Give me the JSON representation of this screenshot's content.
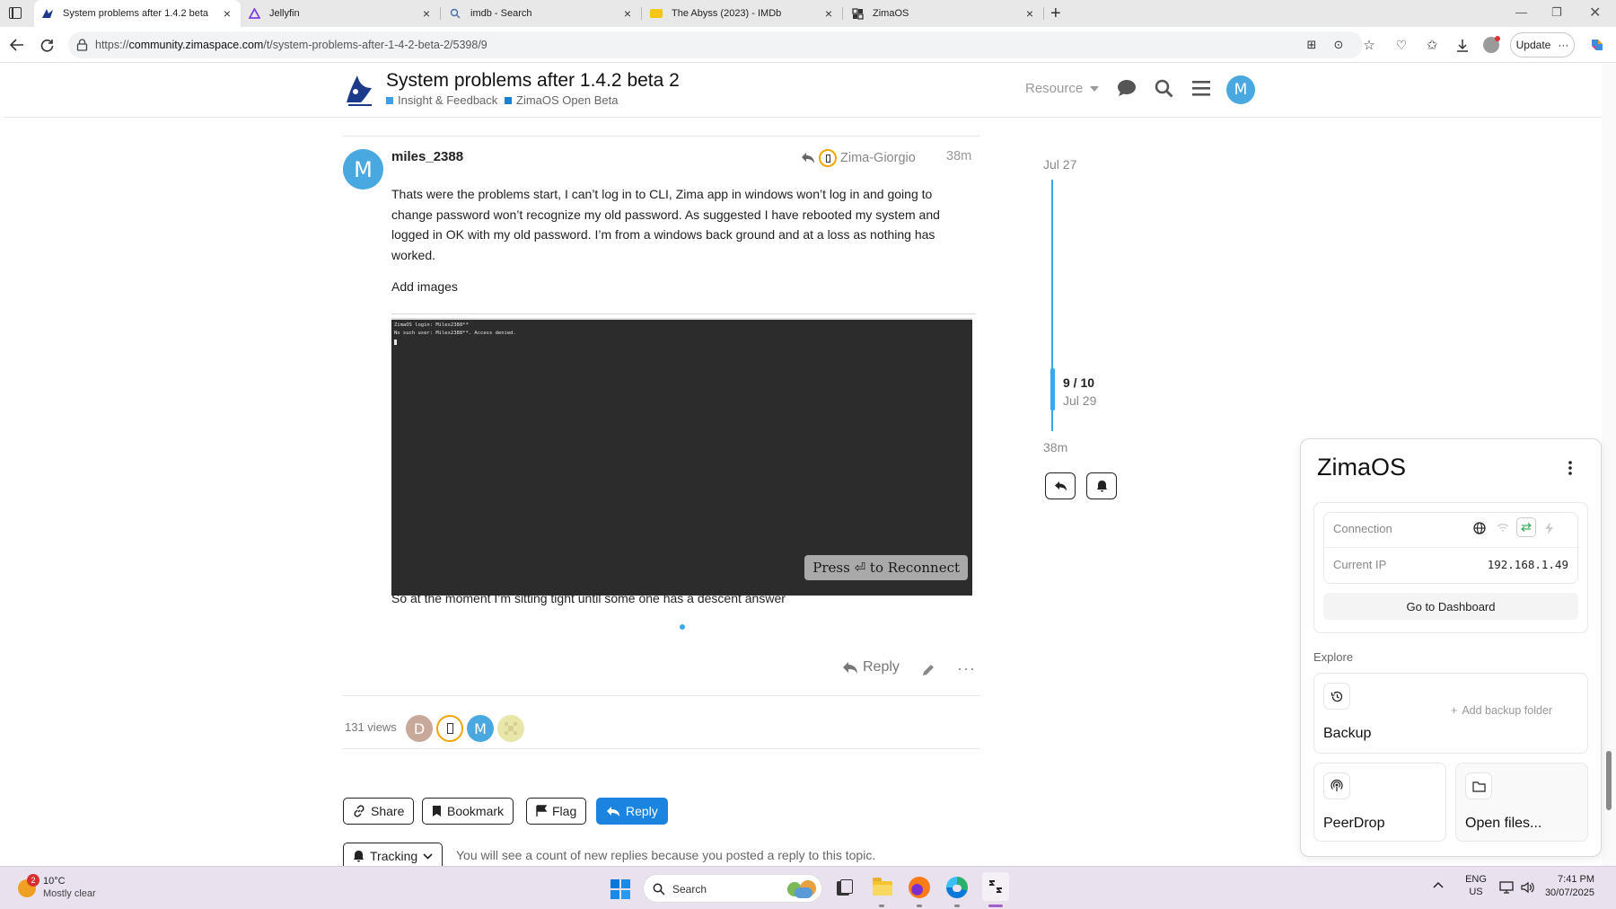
{
  "browser": {
    "tabs": [
      {
        "title": "System problems after 1.4.2 beta",
        "icon": "zimaos-whale-icon",
        "active": true
      },
      {
        "title": "Jellyfin",
        "icon": "jellyfin-icon"
      },
      {
        "title": "imdb - Search",
        "icon": "search-icon"
      },
      {
        "title": "The Abyss (2023) - IMDb",
        "icon": "imdb-icon"
      },
      {
        "title": "ZimaOS",
        "icon": "zimaos-icon"
      }
    ],
    "url_prefix": "https://",
    "url_domain": "community.zimaspace.com",
    "url_path": "/t/system-problems-after-1-4-2-beta-2/5398/9",
    "update_label": "Update"
  },
  "header": {
    "title": "System problems after 1.4.2 beta 2",
    "categories": [
      {
        "label": "Insight & Feedback",
        "color": "#3aa0e8"
      },
      {
        "label": "ZimaOS Open Beta",
        "color": "#1e7ed0"
      }
    ],
    "resource_label": "Resource",
    "avatar_letter": "M"
  },
  "post": {
    "avatar_letter": "M",
    "username": "miles_2388",
    "reply_to": "Zima-Giorgio",
    "time": "38m",
    "paragraph1": "Thats were the problems start, I can’t log in to CLI, Zima app in windows won’t log in and going to change password won’t recognize my old password. As suggested I have rebooted my system and logged in OK with my old password. I’m from a windows back ground and at a loss as nothing has worked.",
    "paragraph2": "Add images",
    "terminal_line1": "ZimaOS login: Miles2388**",
    "terminal_line2": "No such user: Miles2388**. Access denied.",
    "reconnect_label": "Press ⏎ to Reconnect",
    "paragraph3": "So at the moment I’m sitting tight until some one has a descent answer",
    "reply_label": "Reply"
  },
  "footer": {
    "views": "131 views",
    "participants": [
      {
        "letter": "D",
        "color": "#c8a89a"
      },
      {
        "letter": "",
        "color": "#f0a500"
      },
      {
        "letter": "M",
        "color": "#4aa8e0"
      },
      {
        "letter": "",
        "color": "#e8e6a8"
      }
    ],
    "buttons": {
      "share": "Share",
      "bookmark": "Bookmark",
      "flag": "Flag",
      "reply": "Reply"
    },
    "tracking_label": "Tracking",
    "tracking_note": "You will see a count of new replies because you posted a reply to this topic."
  },
  "timeline": {
    "start_date": "Jul 27",
    "position": "9 / 10",
    "current_date": "Jul 29",
    "end_label": "38m"
  },
  "zima_panel": {
    "title": "ZimaOS",
    "connection_label": "Connection",
    "current_ip_label": "Current IP",
    "current_ip": "192.168.1.49",
    "dashboard_button": "Go to Dashboard",
    "explore_label": "Explore",
    "backup_label": "Backup",
    "add_backup_label": "Add backup folder",
    "peerdrop_label": "PeerDrop",
    "open_files_label": "Open files..."
  },
  "taskbar": {
    "weather_badge": "2",
    "temperature": "10°C",
    "weather": "Mostly clear",
    "search_placeholder": "Search",
    "lang_line1": "ENG",
    "lang_line2": "US",
    "time": "7:41 PM",
    "date": "30/07/2025"
  },
  "colors": {
    "accent_blue": "#1b84e0",
    "avatar_blue": "#4aa8e0",
    "timeline_blue": "#3aa8f0"
  }
}
